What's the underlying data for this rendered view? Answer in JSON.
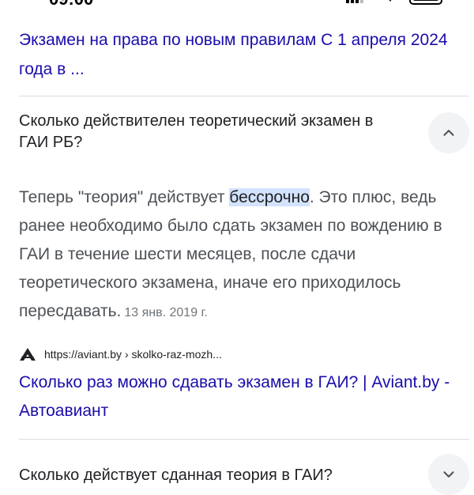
{
  "status_bar": {
    "time": "09:00"
  },
  "top_result": {
    "title": "Экзамен на права по новым правилам С 1 апреля 2024 года в ..."
  },
  "faq": [
    {
      "question": "Сколько действителен теоретический экзамен в ГАИ РБ?",
      "expanded": true,
      "answer_before": "Теперь \"теория\" действует ",
      "answer_highlight": "бессрочно",
      "answer_after": ". Это плюс, ведь ранее необходимо было сдать экзамен по вождению в ГАИ в течение шести месяцев, после сдачи теоретического экзамена, иначе его приходилось пересдавать.",
      "date": "13 янв. 2019 г.",
      "source_url": "https://aviant.by › skolko-raz-mozh...",
      "result_title": "Сколько раз можно сдавать экзамен в ГАИ? | Aviant.by - Автоавиант"
    },
    {
      "question": "Сколько действует сданная теория в ГАИ?",
      "expanded": false
    }
  ],
  "icons": {
    "chevron_up": "chevron-up-icon",
    "chevron_down": "chevron-down-icon",
    "site_logo": "aviant-logo-icon"
  },
  "colors": {
    "link": "#1a0dab",
    "highlight": "#d3e3fd",
    "text": "#202124",
    "secondary_text": "#4d5156",
    "chevron_bg": "#f1f3f4"
  }
}
